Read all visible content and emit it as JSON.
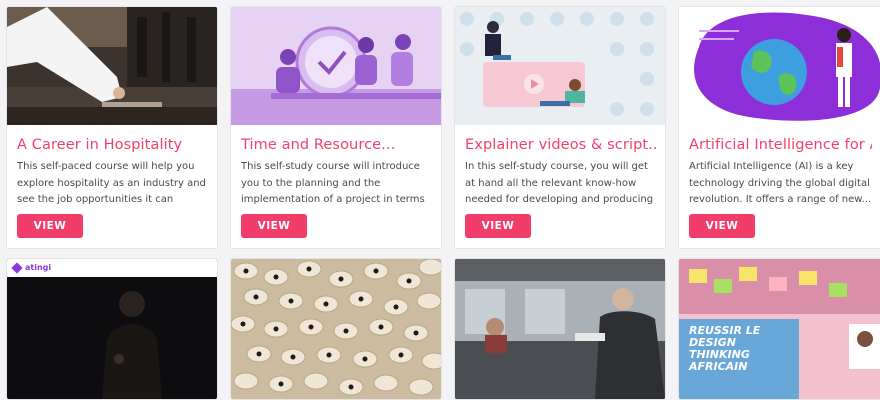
{
  "courses": [
    {
      "title": "A Career in Hospitality",
      "description": "This self-paced course will help you explore hospitality as an industry and see the job opportunities it can offer....",
      "button": "VIEW"
    },
    {
      "title": "Time and Resource...",
      "description": "This self-study course will introduce you to the planning and the implementation of a project in terms o...",
      "button": "VIEW"
    },
    {
      "title": "Explainer videos & script...",
      "description": "In this self-study course, you will get at hand all the relevant know-how needed for developing and producing your firs...",
      "button": "VIEW"
    },
    {
      "title": "Artificial Intelligence for AI...",
      "description": "Artificial Intelligence (AI) is a key technology driving the global digital revolution. It offers a range of new...",
      "button": "VIEW"
    }
  ],
  "row2": {
    "atingi_logo": "atingi",
    "design_thinking_text": "REUSSIR LE DESIGN THINKING AFRICAIN"
  },
  "colors": {
    "accent": "#f23c6a",
    "title": "#f0416b"
  }
}
